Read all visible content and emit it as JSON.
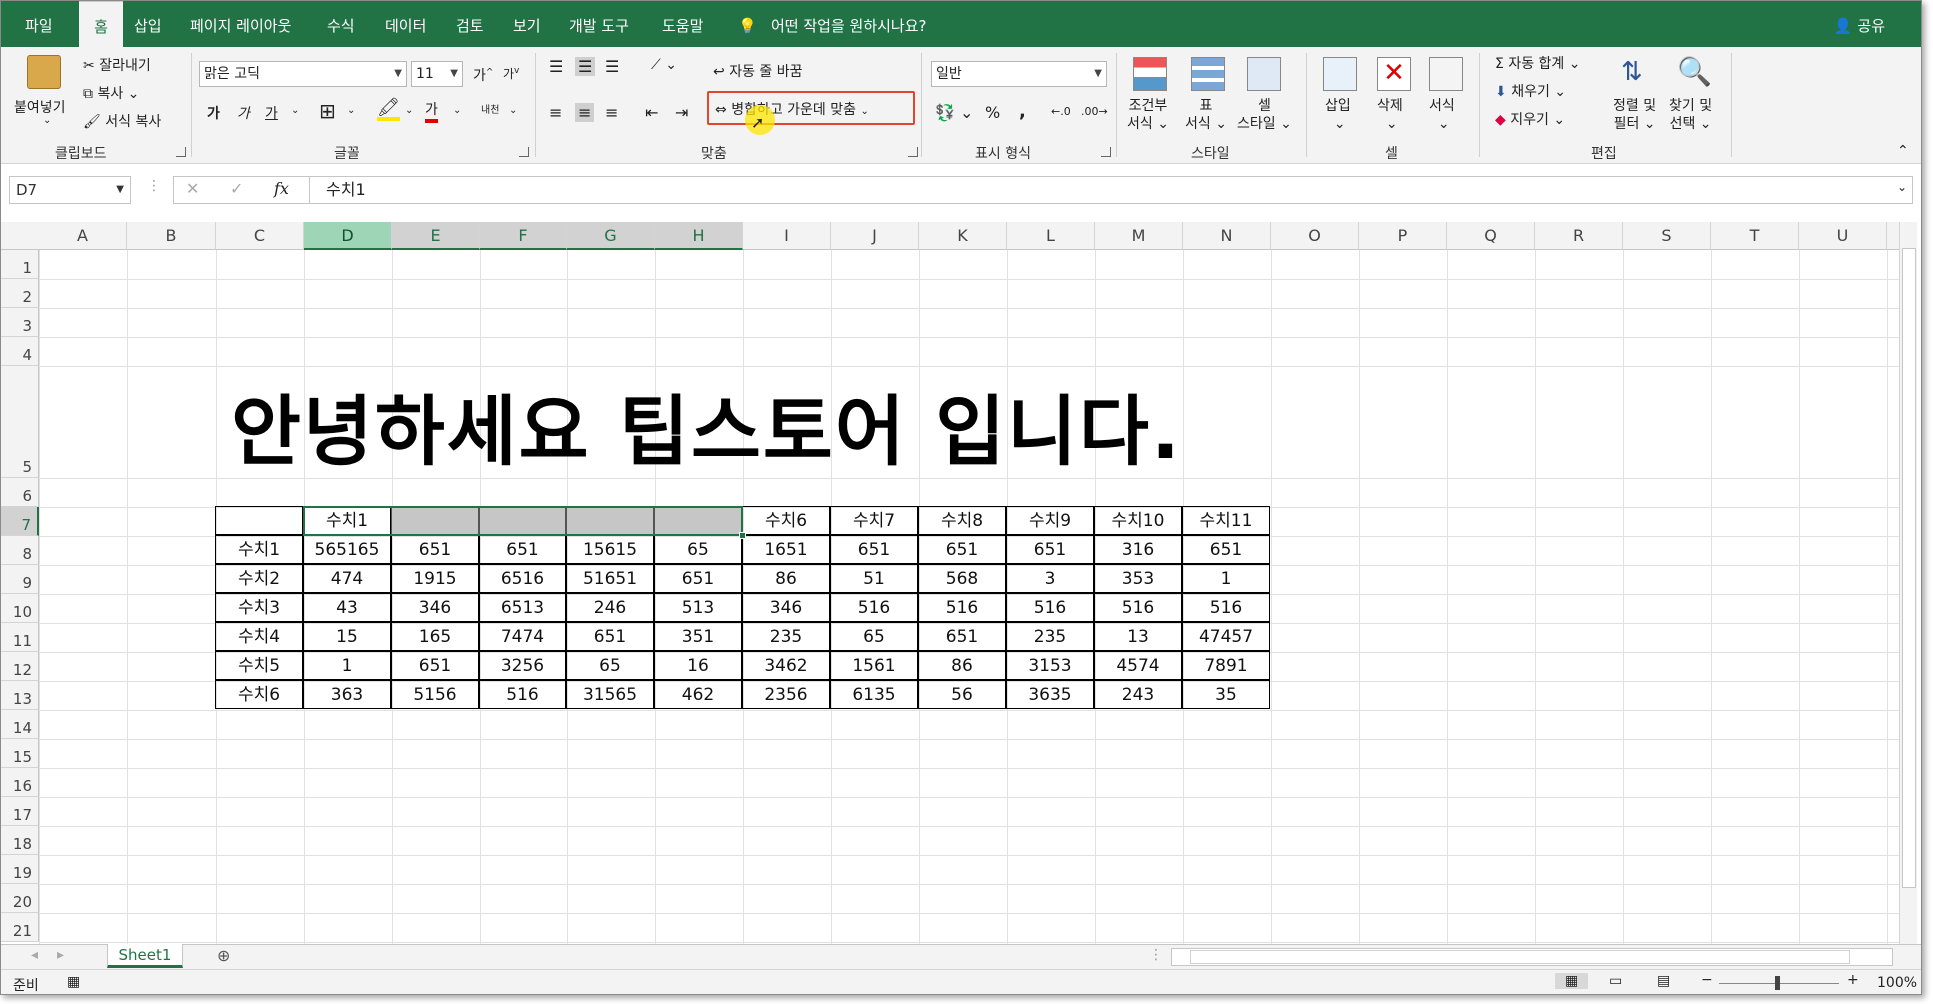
{
  "tabs": [
    "파일",
    "홈",
    "삽입",
    "페이지 레이아웃",
    "수식",
    "데이터",
    "검토",
    "보기",
    "개발 도구",
    "도움말"
  ],
  "tell_me": "어떤 작업을 원하시나요?",
  "share": "공유",
  "clipboard": {
    "paste": "붙여넣기",
    "cut": "잘라내기",
    "copy": "복사",
    "format_painter": "서식 복사",
    "label": "클립보드"
  },
  "font": {
    "name": "맑은 고딕",
    "size": "11",
    "grow": "가",
    "shrink": "가",
    "bold": "가",
    "italic": "가",
    "underline": "가",
    "font_color_glyph": "가",
    "phonetic": "내천",
    "label": "글꼴"
  },
  "alignment": {
    "wrap": "자동 줄 바꿈",
    "merge": "병합하고 가운데 맞춤",
    "label": "맞춤"
  },
  "number": {
    "format": "일반",
    "percent": "%",
    "comma": ",",
    "label": "표시 형식"
  },
  "styles": {
    "conditional": [
      "조건부",
      "서식"
    ],
    "table": [
      "표",
      "서식"
    ],
    "cell": [
      "셀",
      "스타일"
    ],
    "label": "스타일"
  },
  "cells": {
    "insert": "삽입",
    "delete": "삭제",
    "format": "서식",
    "label": "셀"
  },
  "editing": {
    "autosum": "자동 합계",
    "fill": "채우기",
    "clear": "지우기",
    "sort": [
      "정렬 및",
      "필터"
    ],
    "find": [
      "찾기 및",
      "선택"
    ],
    "label": "편집"
  },
  "formula_bar": {
    "name_box": "D7",
    "cancel": "✕",
    "enter": "✓",
    "fx": "fx",
    "value": "수치1"
  },
  "columns": [
    "A",
    "B",
    "C",
    "D",
    "E",
    "F",
    "G",
    "H",
    "I",
    "J",
    "K",
    "L",
    "M",
    "N",
    "O",
    "P",
    "Q",
    "R",
    "S",
    "T",
    "U"
  ],
  "rows": [
    "1",
    "2",
    "3",
    "4",
    "5",
    "6",
    "7",
    "8",
    "9",
    "10",
    "11",
    "12",
    "13",
    "14",
    "15",
    "16",
    "17",
    "18",
    "19",
    "20",
    "21"
  ],
  "big_title": "안녕하세요 팁스토어 입니다.",
  "table": {
    "header": [
      "",
      "수치1",
      "",
      "",
      "",
      "",
      "수치6",
      "수치7",
      "수치8",
      "수치9",
      "수치10",
      "수치11"
    ],
    "body": [
      [
        "수치1",
        "565165",
        "651",
        "651",
        "15615",
        "65",
        "1651",
        "651",
        "651",
        "651",
        "316",
        "651"
      ],
      [
        "수치2",
        "474",
        "1915",
        "6516",
        "51651",
        "651",
        "86",
        "51",
        "568",
        "3",
        "353",
        "1"
      ],
      [
        "수치3",
        "43",
        "346",
        "6513",
        "246",
        "513",
        "346",
        "516",
        "516",
        "516",
        "516",
        "516"
      ],
      [
        "수치4",
        "15",
        "165",
        "7474",
        "651",
        "351",
        "235",
        "65",
        "651",
        "235",
        "13",
        "47457"
      ],
      [
        "수치5",
        "1",
        "651",
        "3256",
        "65",
        "16",
        "3462",
        "1561",
        "86",
        "3153",
        "4574",
        "7891"
      ],
      [
        "수치6",
        "363",
        "5156",
        "516",
        "31565",
        "462",
        "2356",
        "6135",
        "56",
        "3635",
        "243",
        "35"
      ]
    ]
  },
  "sheet": "Sheet1",
  "status": {
    "ready": "준비",
    "zoom": "100%"
  }
}
